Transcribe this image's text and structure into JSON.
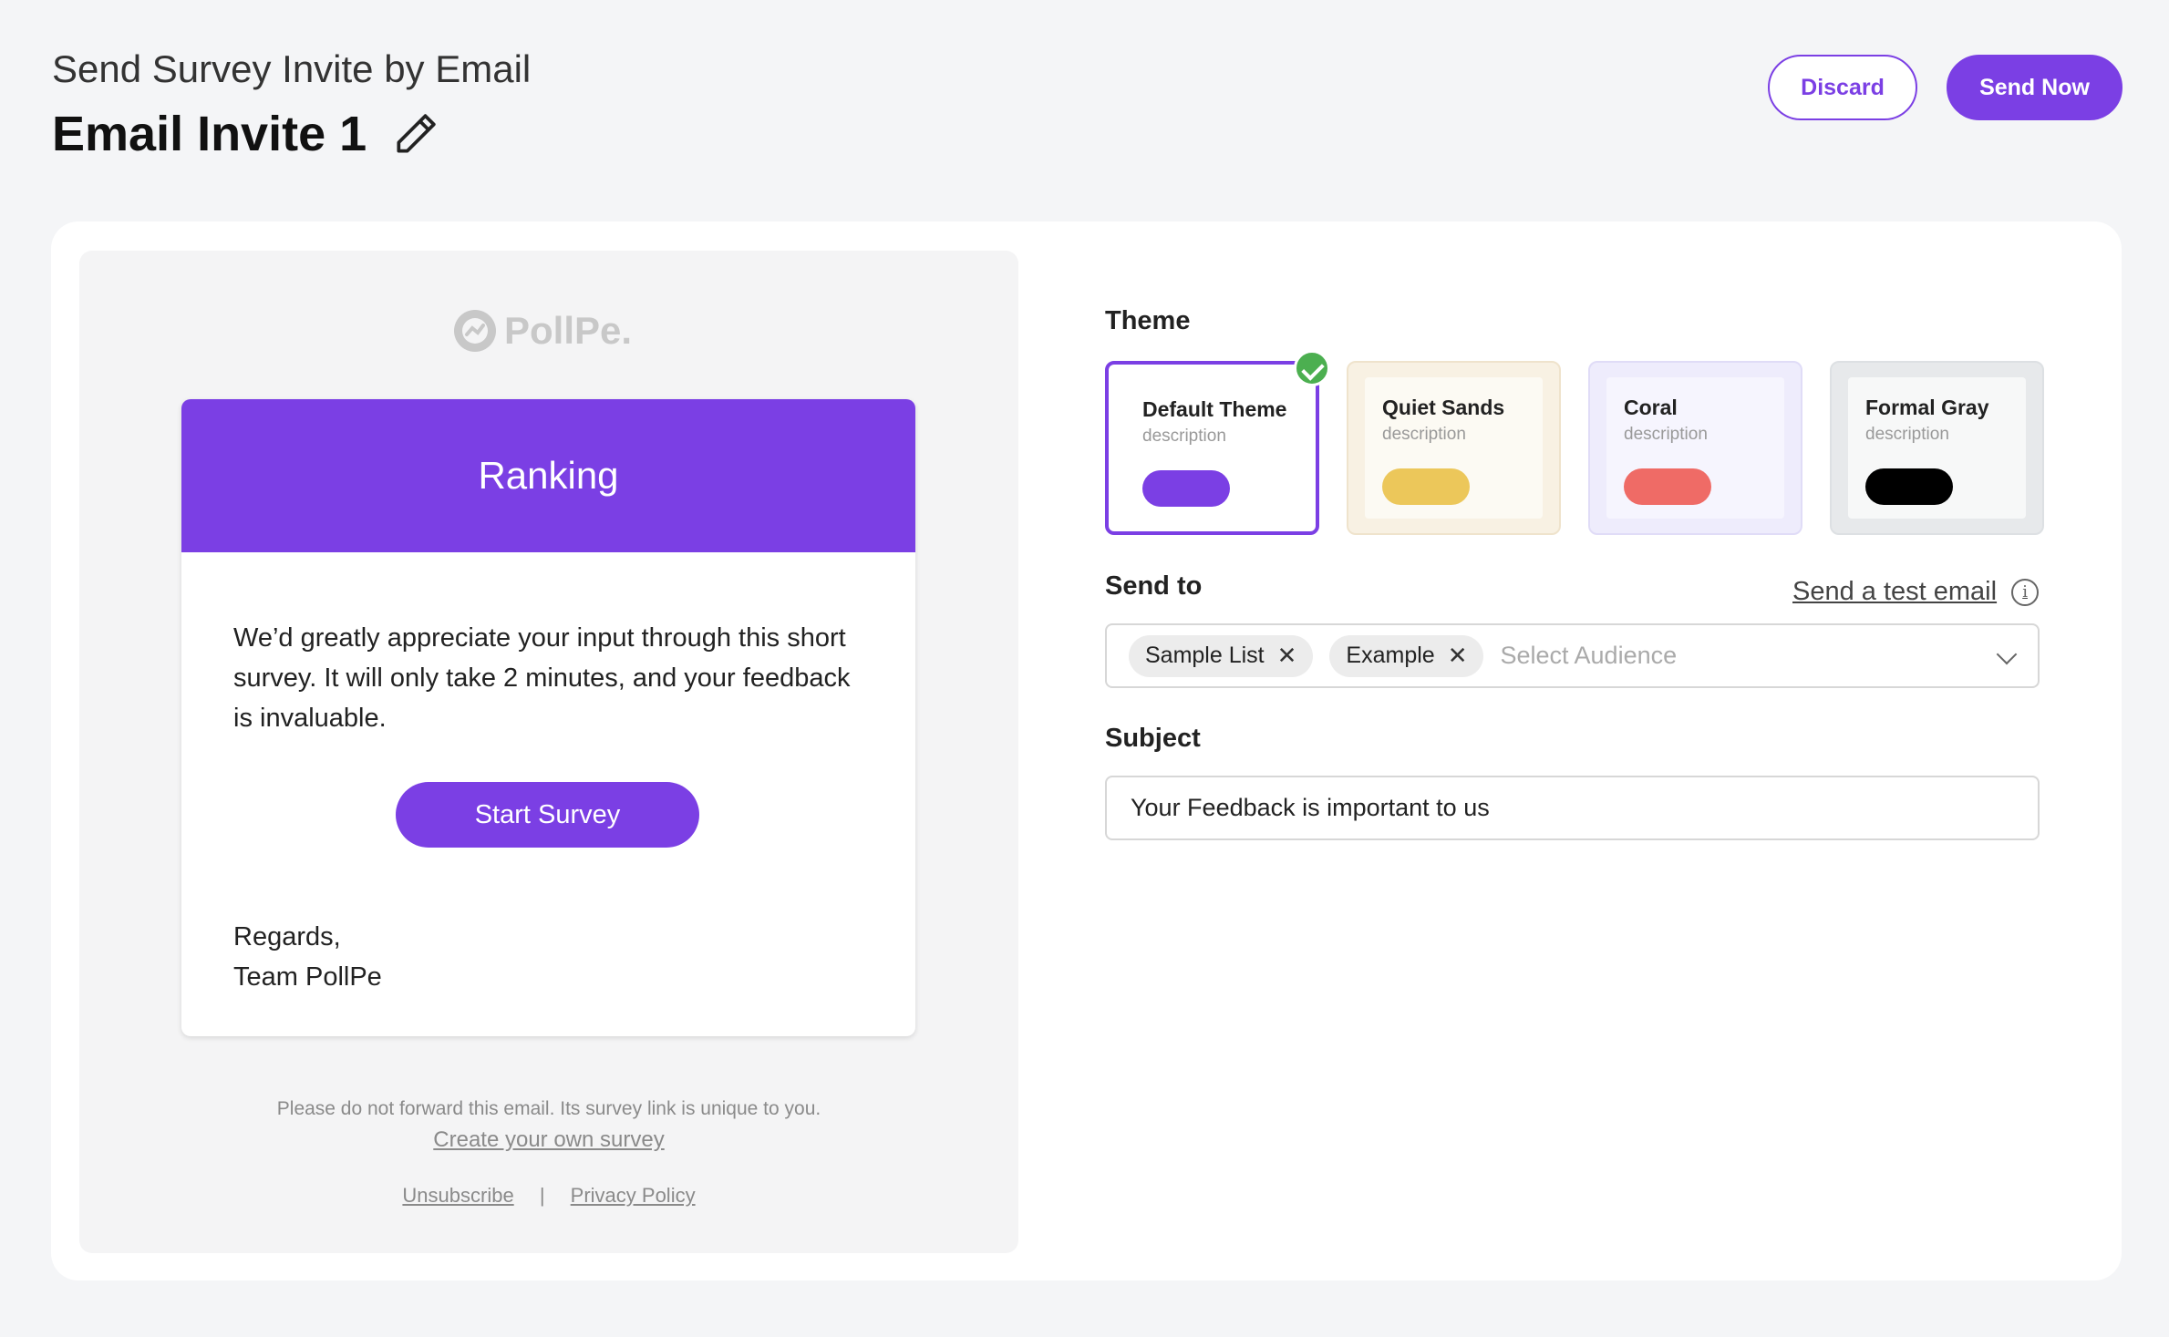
{
  "header": {
    "subtitle": "Send Survey Invite by Email",
    "title": "Email Invite 1",
    "discard_label": "Discard",
    "send_label": "Send Now"
  },
  "preview": {
    "logo_text": "PollPe.",
    "banner_title": "Ranking",
    "body_text": "We’d greatly appreciate your input through this short survey. It will only take 2 minutes, and your feedback is invaluable.",
    "cta_label": "Start Survey",
    "regards_line1": "Regards,",
    "regards_line2": "Team PollPe",
    "footer_note": "Please do not forward this email. Its survey link is unique to you.",
    "create_link": "Create your own survey",
    "unsubscribe": "Unsubscribe",
    "separator": "|",
    "privacy": "Privacy Policy"
  },
  "theme": {
    "label": "Theme",
    "options": [
      {
        "name": "Default Theme",
        "description": "description",
        "border": "#7b3fe4",
        "bg": "#ffffff",
        "inner": "#ffffff",
        "pill": "#7b3fe4",
        "selected": true
      },
      {
        "name": "Quiet Sands",
        "description": "description",
        "border": "#efe3cc",
        "bg": "#f8f1e3",
        "inner": "#fcfaf3",
        "pill": "#ecc75a",
        "selected": false
      },
      {
        "name": "Coral",
        "description": "description",
        "border": "#e0dcf7",
        "bg": "#eeecfc",
        "inner": "#f6f5fe",
        "pill": "#ef6b66",
        "selected": false
      },
      {
        "name": "Formal Gray",
        "description": "description",
        "border": "#dde0e3",
        "bg": "#e7e9eb",
        "inner": "#f7f8f8",
        "pill": "#000000",
        "selected": false
      }
    ]
  },
  "send_to": {
    "label": "Send to",
    "test_email_link": "Send a test email",
    "info_glyph": "i",
    "chips": [
      "Sample List",
      "Example"
    ],
    "chip_remove": "✕",
    "placeholder": "Select Audience"
  },
  "subject": {
    "label": "Subject",
    "value": "Your Feedback is important to us"
  }
}
